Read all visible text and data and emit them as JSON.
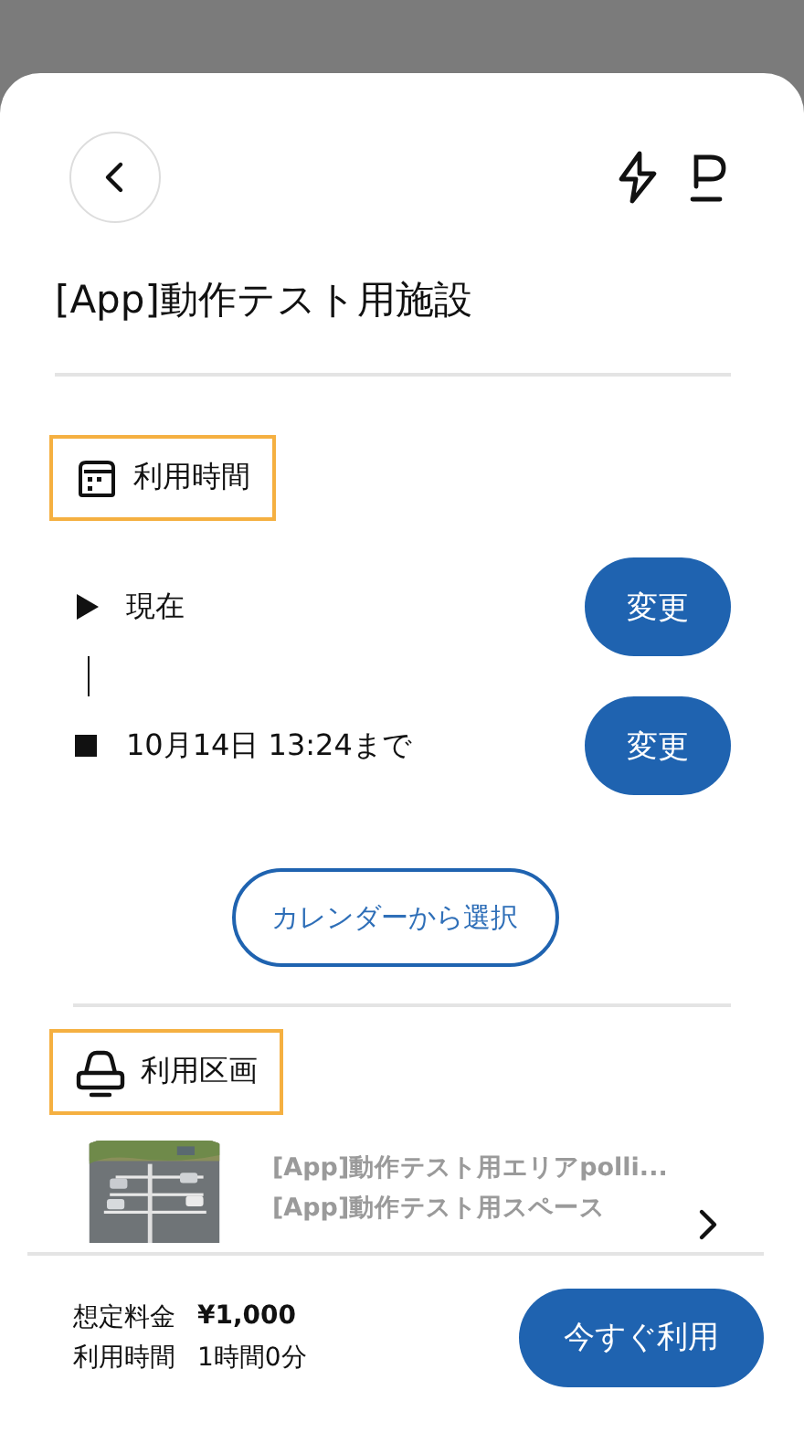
{
  "header": {
    "title": "[App]動作テスト用施設"
  },
  "time_section": {
    "label": "利用時間",
    "rows": [
      {
        "kind": "start",
        "text": "現在",
        "button": "変更"
      },
      {
        "kind": "end",
        "text": "10月14日 13:24まで",
        "button": "変更"
      }
    ],
    "calendar_button": "カレンダーから選択"
  },
  "space_section": {
    "label": "利用区画",
    "lines": [
      "[App]動作テスト用エリアpolli...",
      "[App]動作テスト用スペース"
    ]
  },
  "footer": {
    "fee_label": "想定料金",
    "fee": "¥1,000",
    "duration_label": "利用時間",
    "duration": "1時間0分",
    "button": "今すぐ利用"
  }
}
